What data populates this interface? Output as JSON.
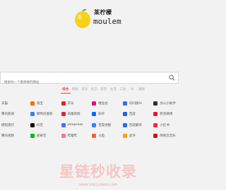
{
  "brand": {
    "name_cn": "某柠檬",
    "name_en": "moulem"
  },
  "search": {
    "placeholder": "搜索你一个最想要的网站"
  },
  "tabs": [
    {
      "label": "综合",
      "active": true
    },
    {
      "label": "购物",
      "active": false
    },
    {
      "label": "资讯",
      "active": false
    },
    {
      "label": "社交",
      "active": false
    },
    {
      "label": "影音",
      "active": false
    },
    {
      "label": "生活",
      "active": false
    },
    {
      "label": "工具",
      "active": false
    },
    {
      "label": "AI",
      "active": false
    },
    {
      "label": "趣味",
      "active": false
    }
  ],
  "rows": [
    {
      "first": "天猫",
      "sites": [
        {
          "label": "淘宝",
          "color": "#ff6a00"
        },
        {
          "label": "京东",
          "color": "#e1251b"
        },
        {
          "label": "唯品会",
          "color": "#f10180"
        },
        {
          "label": "问问搜AI",
          "color": "#3b6cf6"
        },
        {
          "label": "办公小助手",
          "color": "#2e2e2e"
        }
      ]
    },
    {
      "first": "腾讯新闻",
      "sites": [
        {
          "label": "鲸鸭问搜索",
          "color": "#3c7bf5"
        },
        {
          "label": "凤凰新闻",
          "color": "#d9282f"
        },
        {
          "label": "知乎",
          "color": "#0a66ff"
        },
        {
          "label": "百度",
          "color": "#2d5fe0"
        },
        {
          "label": "新浪微博",
          "color": "#e6162d"
        }
      ]
    },
    {
      "first": "携程旅行",
      "sites": [
        {
          "label": "抖音",
          "color": "#111111"
        },
        {
          "label": "Deepseek",
          "color": "#4d6bfe"
        },
        {
          "label": "百度地图",
          "color": "#3385ff"
        },
        {
          "label": "百度翻译",
          "color": "#2b6de5"
        },
        {
          "label": "小红书",
          "color": "#ff2442"
        }
      ]
    },
    {
      "first": "腾讯视频",
      "sites": [
        {
          "label": "爱奇艺",
          "color": "#00be06"
        },
        {
          "label": "哔哩哔",
          "color": "#fb7299"
        },
        {
          "label": "斗鱼",
          "color": "#ff5d23"
        },
        {
          "label": "虎牙",
          "color": "#ffa200"
        },
        {
          "label": "网易云音乐",
          "color": "#dd001b"
        }
      ]
    }
  ],
  "watermark": {
    "title": "星链秒收录",
    "url": "WWW.XINGLIANMS.COM"
  }
}
